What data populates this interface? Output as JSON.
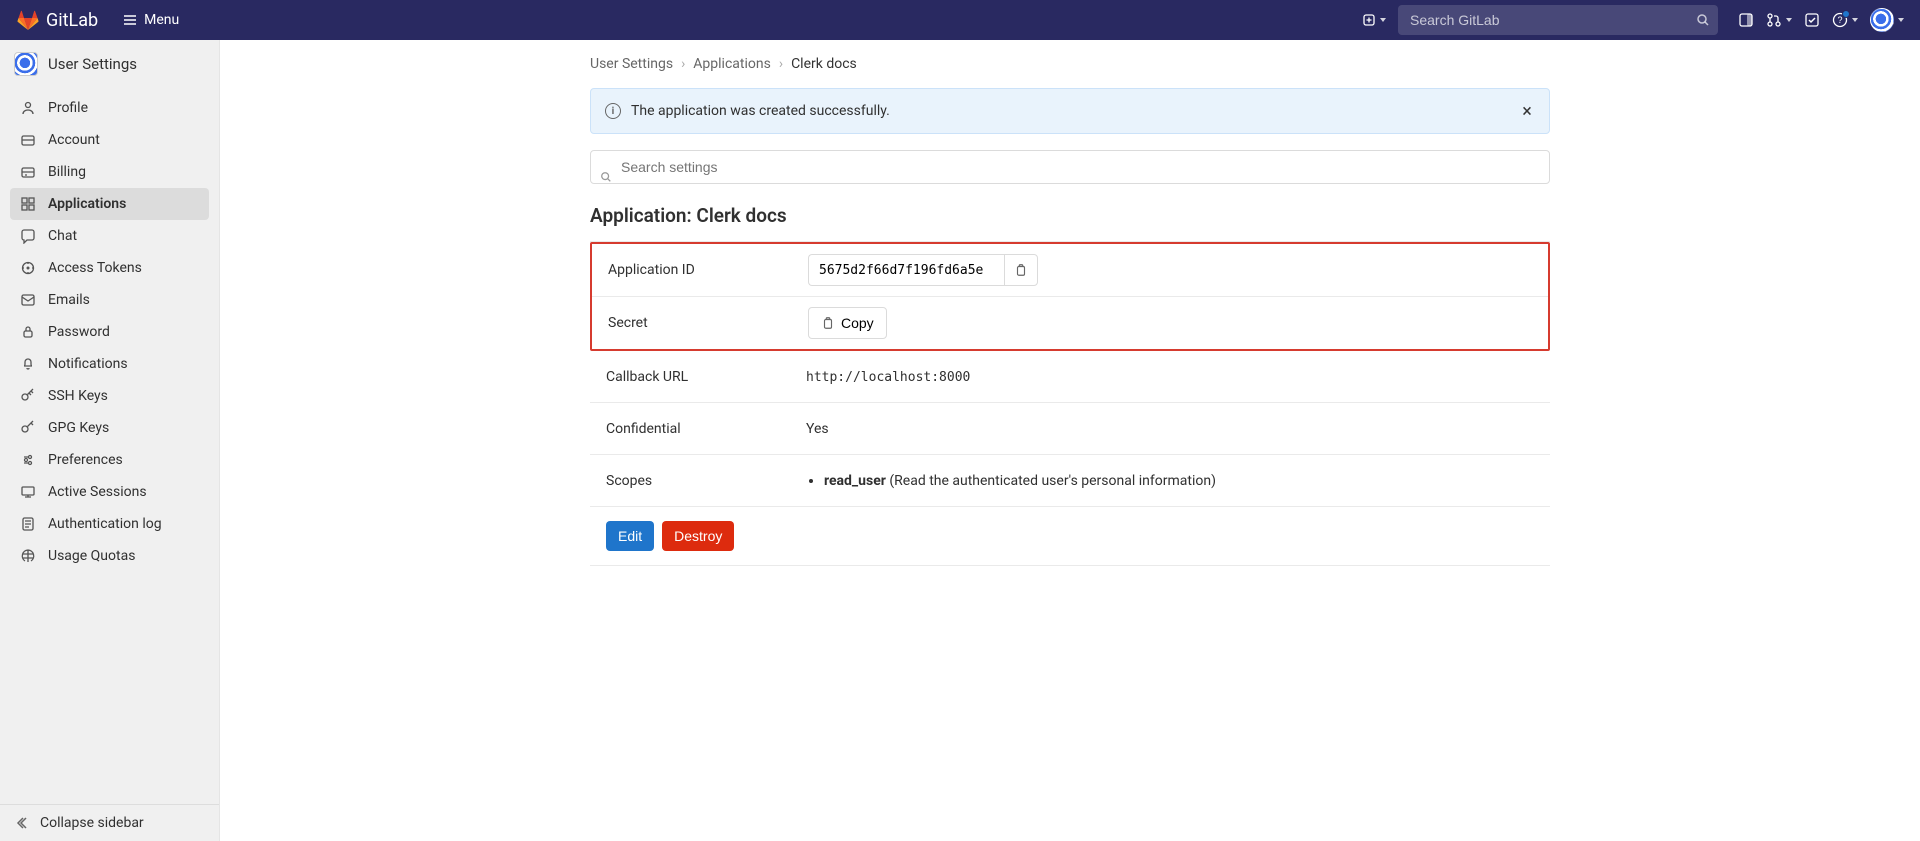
{
  "top_nav": {
    "brand": "GitLab",
    "menu_label": "Menu",
    "search_placeholder": "Search GitLab"
  },
  "sidebar": {
    "title": "User Settings",
    "collapse_label": "Collapse sidebar",
    "items": [
      {
        "label": "Profile"
      },
      {
        "label": "Account"
      },
      {
        "label": "Billing"
      },
      {
        "label": "Applications"
      },
      {
        "label": "Chat"
      },
      {
        "label": "Access Tokens"
      },
      {
        "label": "Emails"
      },
      {
        "label": "Password"
      },
      {
        "label": "Notifications"
      },
      {
        "label": "SSH Keys"
      },
      {
        "label": "GPG Keys"
      },
      {
        "label": "Preferences"
      },
      {
        "label": "Active Sessions"
      },
      {
        "label": "Authentication log"
      },
      {
        "label": "Usage Quotas"
      }
    ],
    "active_index": 3
  },
  "breadcrumbs": [
    {
      "label": "User Settings"
    },
    {
      "label": "Applications"
    },
    {
      "label": "Clerk docs"
    }
  ],
  "alert": {
    "message": "The application was created successfully."
  },
  "settings_search_placeholder": "Search settings",
  "application": {
    "title": "Application: Clerk docs",
    "rows": {
      "app_id": {
        "label": "Application ID",
        "value": "5675d2f66d7f196fd6a5e"
      },
      "secret": {
        "label": "Secret",
        "copy_label": "Copy"
      },
      "callback": {
        "label": "Callback URL",
        "value": "http://localhost:8000"
      },
      "confidential": {
        "label": "Confidential",
        "value": "Yes"
      },
      "scopes": {
        "label": "Scopes",
        "items": [
          {
            "name": "read_user",
            "desc": "(Read the authenticated user's personal information)"
          }
        ]
      }
    }
  },
  "actions": {
    "edit": "Edit",
    "destroy": "Destroy"
  }
}
